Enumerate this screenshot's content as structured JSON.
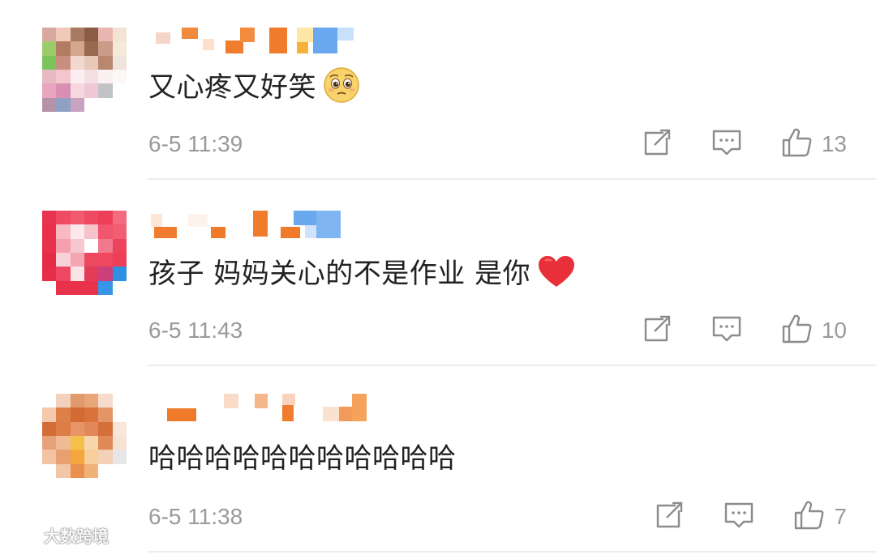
{
  "comments": [
    {
      "text": "又心疼又好笑",
      "emoji_icon": "pleading-face-emoji-icon",
      "timestamp": "6-5 11:39",
      "like_count": "13"
    },
    {
      "text": "孩子 妈妈关心的不是作业 是你",
      "emoji_icon": "red-heart-emoji-icon",
      "timestamp": "6-5 11:43",
      "like_count": "10"
    },
    {
      "text": "哈哈哈哈哈哈哈哈哈哈哈",
      "emoji_icon": "",
      "timestamp": "6-5 11:38",
      "like_count": "7"
    }
  ],
  "icons": {
    "share": "share-icon",
    "reply": "comment-icon",
    "like": "thumbs-up-icon"
  },
  "watermark": {
    "text": "大数跨境",
    "logo": "weibo-logo"
  },
  "colors": {
    "text": "#222222",
    "meta": "#9a9a9a",
    "divider": "#ececec",
    "icon": "#8c8c8c"
  }
}
